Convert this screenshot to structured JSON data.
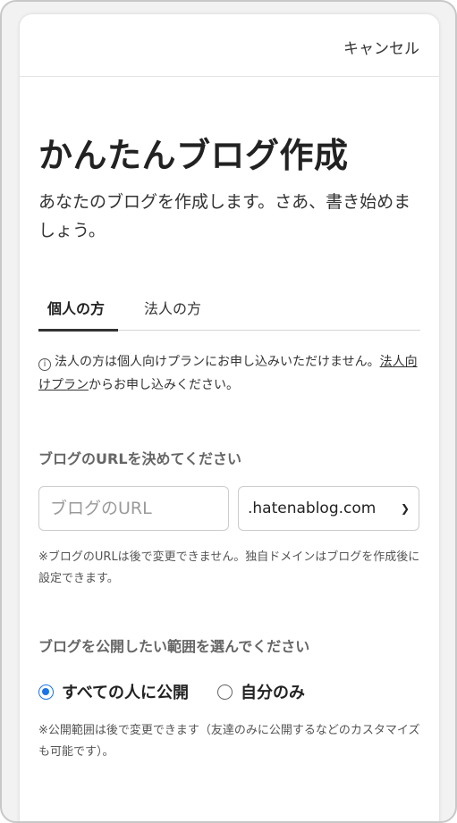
{
  "header": {
    "cancel_label": "キャンセル"
  },
  "page": {
    "title": "かんたんブログ作成",
    "subtitle": "あなたのブログを作成します。さあ、書き始めましょう。"
  },
  "tabs": [
    {
      "label": "個人の方",
      "active": true
    },
    {
      "label": "法人の方",
      "active": false
    }
  ],
  "notice": {
    "text_before": "法人の方は個人向けプランにお申し込みいただけません。",
    "link_label": "法人向けプラン",
    "text_after": "からお申し込みください。"
  },
  "url_section": {
    "label": "ブログのURLを決めてください",
    "input_value": "",
    "input_placeholder": "ブログのURL",
    "domain_selected": ".hatenablog.com",
    "note": "※ブログのURLは後で変更できません。独自ドメインはブログを作成後に設定できます。"
  },
  "publish_section": {
    "label": "ブログを公開したい範囲を選んでください",
    "options": [
      {
        "label": "すべての人に公開",
        "checked": true
      },
      {
        "label": "自分のみ",
        "checked": false
      }
    ],
    "note": "※公開範囲は後で変更できます（友達のみに公開するなどのカスタマイズも可能です）。"
  },
  "colors": {
    "accent": "#1a73e8",
    "text": "#222222",
    "muted": "#666666"
  }
}
